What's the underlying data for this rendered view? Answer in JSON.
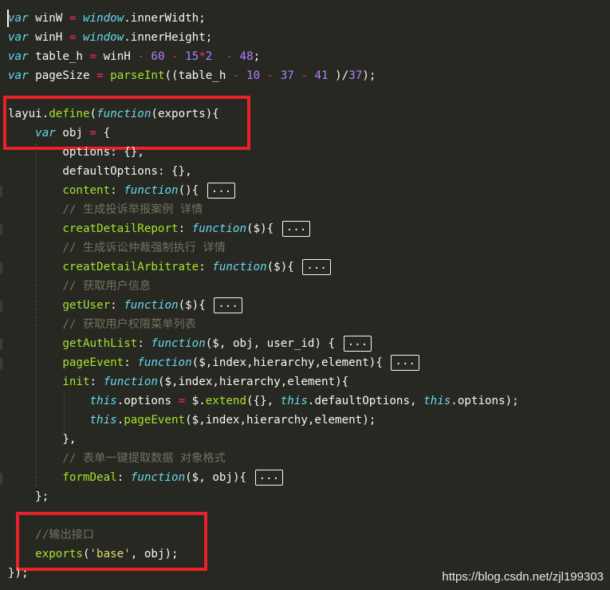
{
  "lines": [
    "var winW = window.innerWidth;",
    "var winH = window.innerHeight;",
    "var table_h = winH - 60 - 15*2  - 48;",
    "var pageSize = parseInt((table_h - 10 - 37 - 41 )/37);",
    "",
    "layui.define(function(exports){",
    "    var obj = {",
    "        options: {},",
    "        defaultOptions: {},",
    "        content: function(){ ...",
    "        // 生成投诉举报案例 详情",
    "        creatDetailReport: function($){ ...",
    "        // 生成诉讼仲裁强制执行 详情",
    "        creatDetailArbitrate: function($){ ...",
    "        // 获取用户信息",
    "        getUser: function($){ ...",
    "        // 获取用户权限菜单列表",
    "        getAuthList: function($, obj, user_id) { ...",
    "        pageEvent: function($,index,hierarchy,element){ ...",
    "        init: function($,index,hierarchy,element){",
    "            this.options = $.extend({}, this.defaultOptions, this.options);",
    "            this.pageEvent($,index,hierarchy,element);",
    "        },",
    "        // 表单一键提取数据 对象格式",
    "        formDeal: function($, obj){ ...",
    "    };",
    "",
    "    //输出接口",
    "    exports('base', obj);",
    "});"
  ],
  "fold_marker": "...",
  "watermark": "https://blog.csdn.net/zjl199303",
  "colors": {
    "background": "#272822",
    "keyword": "#66d9ef",
    "function_name": "#a6e22e",
    "number": "#ae81ff",
    "operator": "#f92672",
    "string": "#e6db74",
    "comment": "#75715e",
    "highlight_box": "#e8212b"
  }
}
